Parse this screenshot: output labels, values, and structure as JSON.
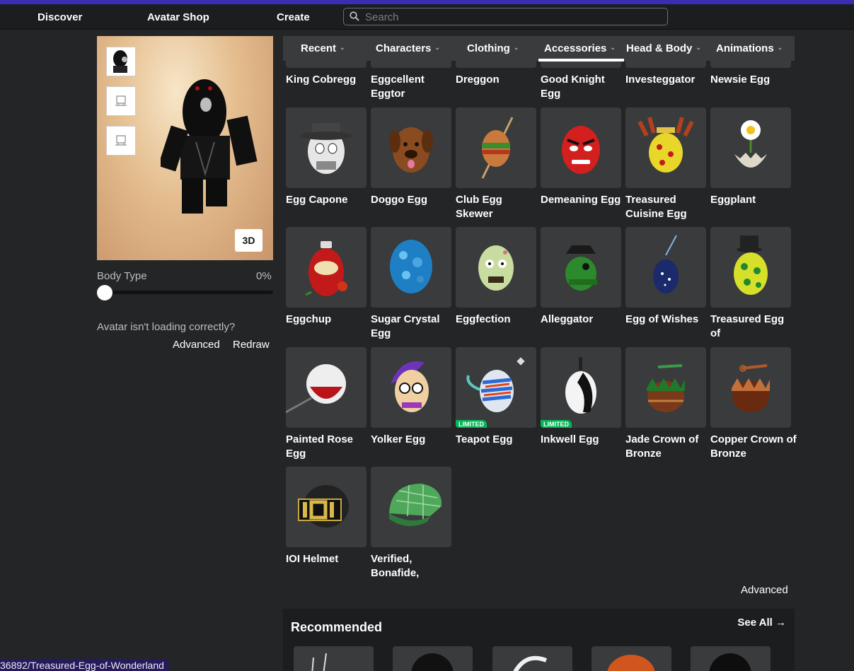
{
  "nav": {
    "discover": "Discover",
    "avatar_shop": "Avatar Shop",
    "create": "Create",
    "search_placeholder": "Search"
  },
  "preview": {
    "mode_button": "3D",
    "body_type_label": "Body Type",
    "body_type_value": "0%",
    "body_type_fraction": 0,
    "loading_msg": "Avatar isn't loading correctly?",
    "advanced": "Advanced",
    "redraw": "Redraw"
  },
  "tabs": [
    {
      "label": "Recent"
    },
    {
      "label": "Characters"
    },
    {
      "label": "Clothing"
    },
    {
      "label": "Accessories",
      "selected": true
    },
    {
      "label": "Head & Body"
    },
    {
      "label": "Animations"
    }
  ],
  "items": [
    {
      "name": "King Cobregg"
    },
    {
      "name": "Eggcellent Eggtor"
    },
    {
      "name": "Dreggon"
    },
    {
      "name": "Good Knight Egg"
    },
    {
      "name": "Investeggator"
    },
    {
      "name": "Newsie Egg"
    },
    {
      "name": "Egg Capone"
    },
    {
      "name": "Doggo Egg"
    },
    {
      "name": "Club Egg Skewer"
    },
    {
      "name": "Demeaning Egg"
    },
    {
      "name": "Treasured Cuisine Egg"
    },
    {
      "name": "Eggplant"
    },
    {
      "name": "Eggchup"
    },
    {
      "name": "Sugar Crystal Egg"
    },
    {
      "name": "Eggfection"
    },
    {
      "name": "Alleggator"
    },
    {
      "name": "Egg of Wishes"
    },
    {
      "name": "Treasured Egg of"
    },
    {
      "name": "Painted Rose Egg"
    },
    {
      "name": "Yolker Egg"
    },
    {
      "name": "Teapot Egg",
      "badge": "LIMITED"
    },
    {
      "name": "Inkwell Egg",
      "badge": "LIMITED"
    },
    {
      "name": "Jade Crown of Bronze"
    },
    {
      "name": "Copper Crown of Bronze"
    },
    {
      "name": "IOI Helmet"
    },
    {
      "name": "Verified, Bonafide,"
    }
  ],
  "footer": {
    "advanced": "Advanced",
    "recommended_title": "Recommended",
    "see_all": "See All →"
  },
  "status_url": "36892/Treasured-Egg-of-Wonderland",
  "colors": {
    "accent_bar": "#3b2db0",
    "limited_badge": "#02b757",
    "background": "#232527",
    "card": "#393b3d"
  }
}
